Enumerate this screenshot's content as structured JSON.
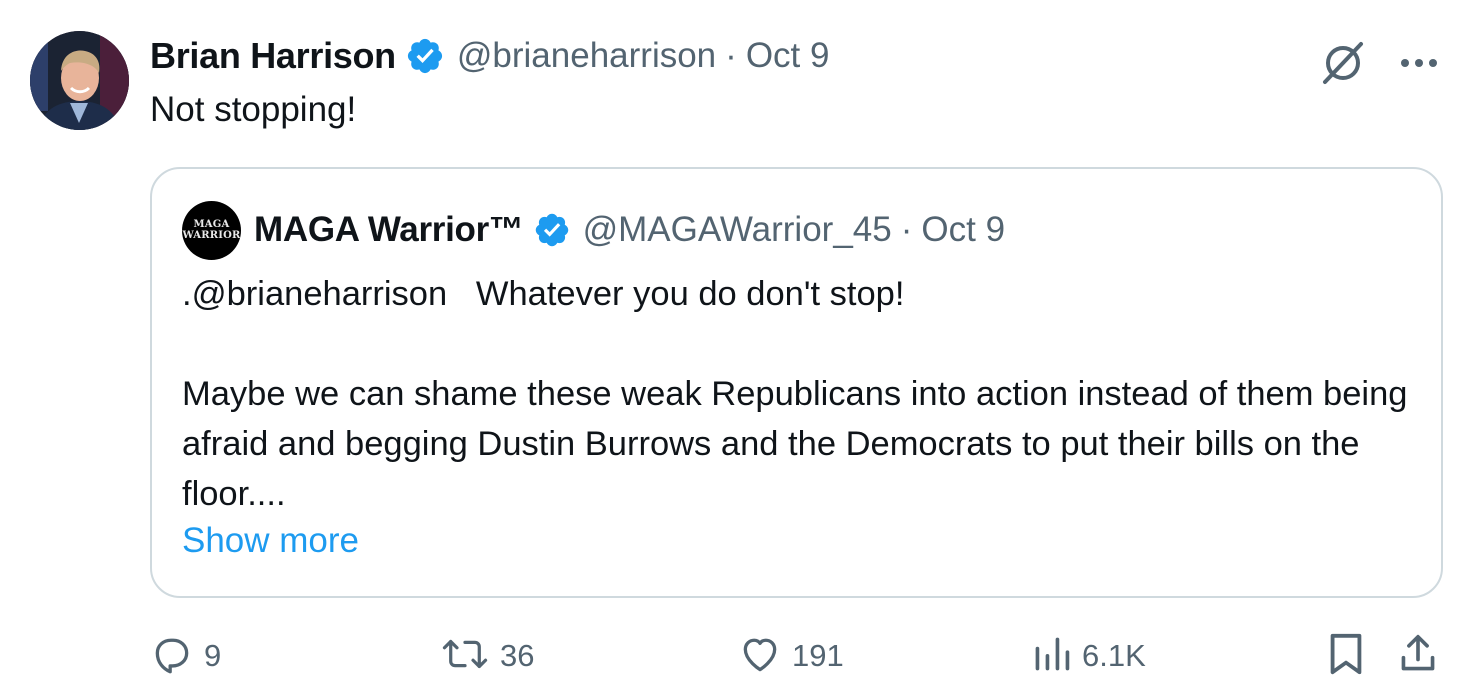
{
  "tweet": {
    "author_name": "Brian Harrison",
    "author_handle": "@brianeharrison",
    "separator": "·",
    "date": "Oct 9",
    "text": "Not stopping!",
    "icons": {
      "verified": "verified-badge-icon",
      "grok": "grok-icon",
      "more": "more-icon"
    }
  },
  "quote": {
    "author_name": "MAGA Warrior™",
    "author_handle": "@MAGAWarrior_45",
    "separator": "·",
    "date": "Oct 9",
    "avatar_text_line1": "MAGA",
    "avatar_text_line2": "WARRIOR",
    "paragraph1": ".@brianeharrison   Whatever you do don't stop!",
    "paragraph2": "Maybe we can shame these weak Republicans into action instead of them being afraid and begging Dustin Burrows and the Democrats to put their bills on the floor....",
    "show_more": "Show more"
  },
  "actions": {
    "replies": "9",
    "retweets": "36",
    "likes": "191",
    "views": "6.1K",
    "icons": [
      "reply-icon",
      "retweet-icon",
      "like-icon",
      "views-icon",
      "bookmark-icon",
      "share-icon"
    ]
  },
  "colors": {
    "text": "#0f1419",
    "secondary": "#536471",
    "link": "#1d9bf0",
    "verified": "#1d9bf0",
    "border": "#cfd9de"
  }
}
